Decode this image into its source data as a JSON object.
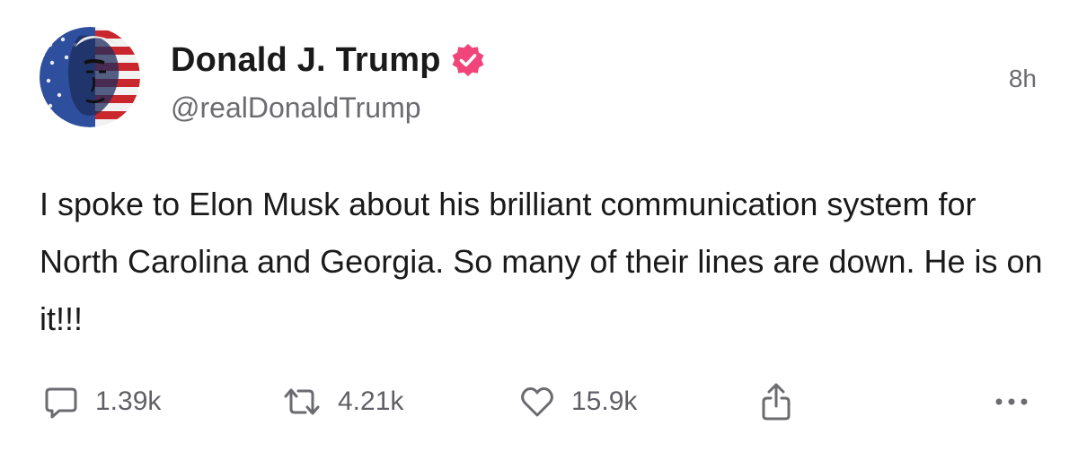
{
  "post": {
    "author": {
      "display_name": "Donald J. Trump",
      "handle": "@realDonaldTrump",
      "verified": true,
      "avatar_icon": "avatar-flag-portrait"
    },
    "timestamp": "8h",
    "text": "I spoke to Elon Musk about his brilliant communication system for North Carolina and Georgia. So many of their lines are down. He is on it!!!",
    "actions": {
      "replies": "1.39k",
      "reposts": "4.21k",
      "likes": "15.9k"
    }
  },
  "icons": {
    "verified": "verified-badge-icon",
    "reply": "comment-icon",
    "repost": "repost-icon",
    "like": "heart-icon",
    "share": "share-icon",
    "more": "more-dots-icon"
  },
  "colors": {
    "verified_badge": "#f0447a",
    "text_primary": "#1a1a1a",
    "text_secondary": "#6b6b70",
    "background": "#ffffff"
  }
}
